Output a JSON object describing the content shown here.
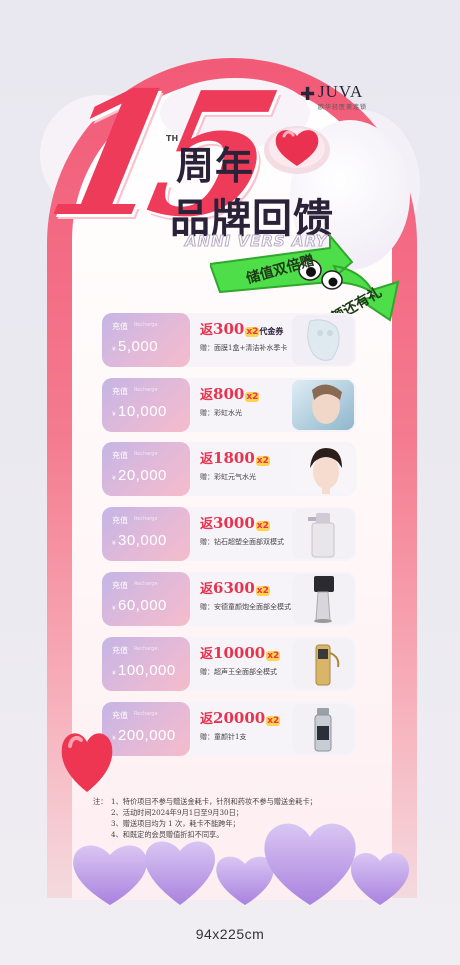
{
  "brand": {
    "logo_name": "JUVA",
    "logo_sub": "欧华轻医美连锁"
  },
  "hero": {
    "number": "15",
    "superscript": "TH",
    "title_line1": "周年",
    "title_line2": "品牌回馈",
    "anniversary": "ANNI VERS ARY",
    "arrow_text1": "储值双倍赠",
    "arrow_text2": "满额还有礼"
  },
  "tiers": [
    {
      "label": "充值",
      "label_en": "Recharge",
      "currency": "¥",
      "amount": "5,000",
      "return_prefix": "返",
      "return_value": "300",
      "multiplier": "x2",
      "return_suffix": "代金券",
      "gift": "赠：面膜1盒+清洁补水季卡",
      "image": "mask-product"
    },
    {
      "label": "充值",
      "label_en": "Recharge",
      "currency": "¥",
      "amount": "10,000",
      "return_prefix": "返",
      "return_value": "800",
      "multiplier": "x2",
      "return_suffix": "",
      "gift": "赠：彩虹水光",
      "image": "woman-water-photo"
    },
    {
      "label": "充值",
      "label_en": "Recharge",
      "currency": "¥",
      "amount": "20,000",
      "return_prefix": "返",
      "return_value": "1800",
      "multiplier": "x2",
      "return_suffix": "",
      "gift": "赠：彩虹元气水光",
      "image": "woman-face-photo"
    },
    {
      "label": "充值",
      "label_en": "Recharge",
      "currency": "¥",
      "amount": "30,000",
      "return_prefix": "返",
      "return_value": "3000",
      "multiplier": "x2",
      "return_suffix": "",
      "gift": "赠：钻石超塑全面部双模式",
      "image": "device-machine"
    },
    {
      "label": "充值",
      "label_en": "Recharge",
      "currency": "¥",
      "amount": "60,000",
      "return_prefix": "返",
      "return_value": "6300",
      "multiplier": "x2",
      "return_suffix": "",
      "gift": "赠：安德童颜炮全面部全模式",
      "image": "device-cannon"
    },
    {
      "label": "充值",
      "label_en": "Recharge",
      "currency": "¥",
      "amount": "100,000",
      "return_prefix": "返",
      "return_value": "10000",
      "multiplier": "x2",
      "return_suffix": "",
      "gift": "赠：超声王全面部全模式",
      "image": "device-gold"
    },
    {
      "label": "充值",
      "label_en": "Recharge",
      "currency": "¥",
      "amount": "200,000",
      "return_prefix": "返",
      "return_value": "20000",
      "multiplier": "x2",
      "return_suffix": "",
      "gift": "赠：童颜针1支",
      "image": "vial-product"
    }
  ],
  "notes": {
    "prefix": "注：",
    "items": [
      "1、特价项目不参与赠送金耗卡，针剂和药妆不参与赠送金耗卡；",
      "2、活动时间2024年9月1日至9月30日；",
      "3、赠送项目均为 1 次，耗卡不能跨年；",
      "4、和既定的会员赠值折扣不同享。"
    ]
  },
  "caption": "94x225cm",
  "colors": {
    "accent_red": "#ef3b5a",
    "arrow_green": "#4ede4a",
    "card_purple": "#c4b5e6",
    "card_pink": "#f5bccb",
    "heart_purple": "#c4a8e8"
  }
}
